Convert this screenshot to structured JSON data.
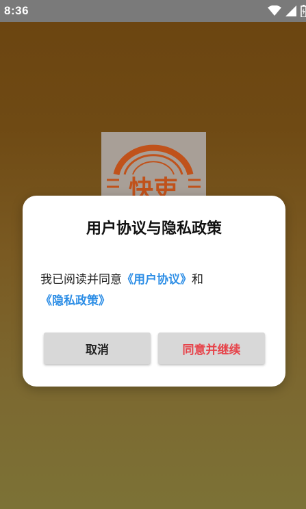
{
  "status_bar": {
    "time": "8:36",
    "icons": [
      "wifi-icon",
      "cellular-signal-icon",
      "battery-charging-icon"
    ]
  },
  "splash": {
    "logo_text": "快吏"
  },
  "dialog": {
    "title": "用户协议与隐私政策",
    "message": {
      "prefix": "我已阅读并同意",
      "user_agreement_link": "《用户协议》",
      "conjunction": "和",
      "privacy_policy_link": "《隐私政策》"
    },
    "cancel_label": "取消",
    "agree_label": "同意并继续"
  },
  "colors": {
    "link": "#2d8ee6",
    "agree_text": "#e7434a",
    "button_bg": "#d8d8d8",
    "logo_orange": "#c0521b"
  }
}
